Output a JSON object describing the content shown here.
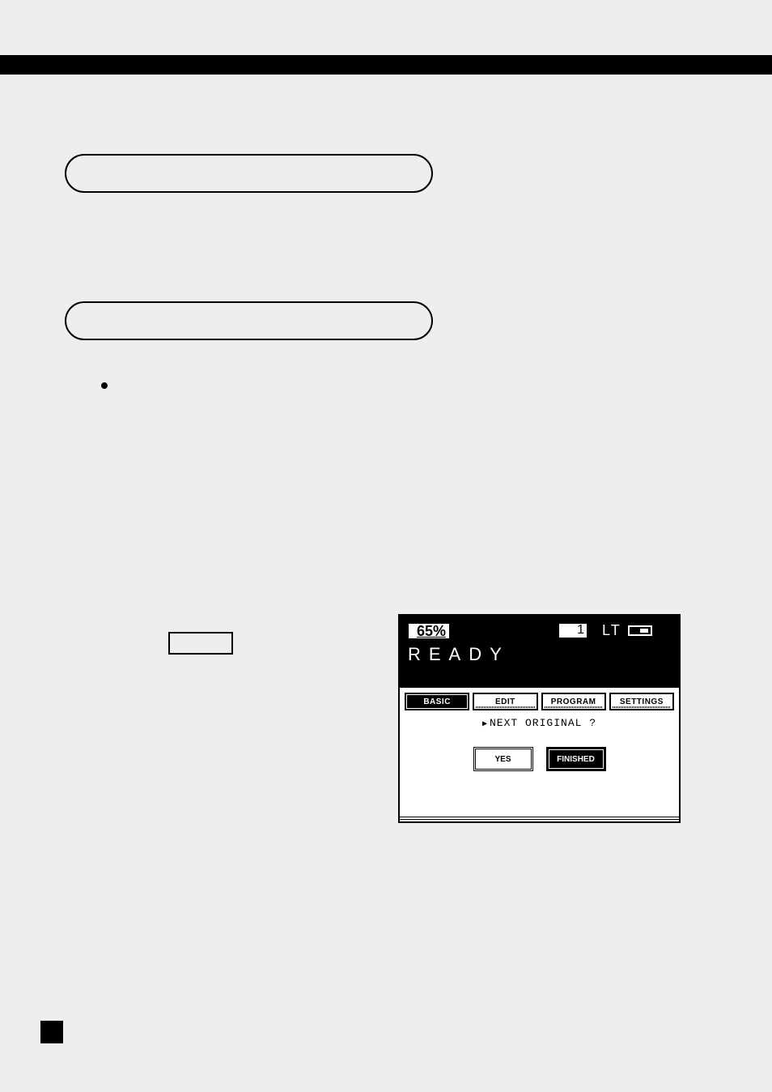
{
  "lcd": {
    "zoom": "65%",
    "copies": "1",
    "paper_label": "LT",
    "status": "READY",
    "tabs": {
      "basic": "BASIC",
      "edit": "EDIT",
      "program": "PROGRAM",
      "settings": "SETTINGS"
    },
    "prompt": "NEXT ORIGINAL ?",
    "buttons": {
      "yes": "YES",
      "finished": "FINISHED"
    }
  }
}
